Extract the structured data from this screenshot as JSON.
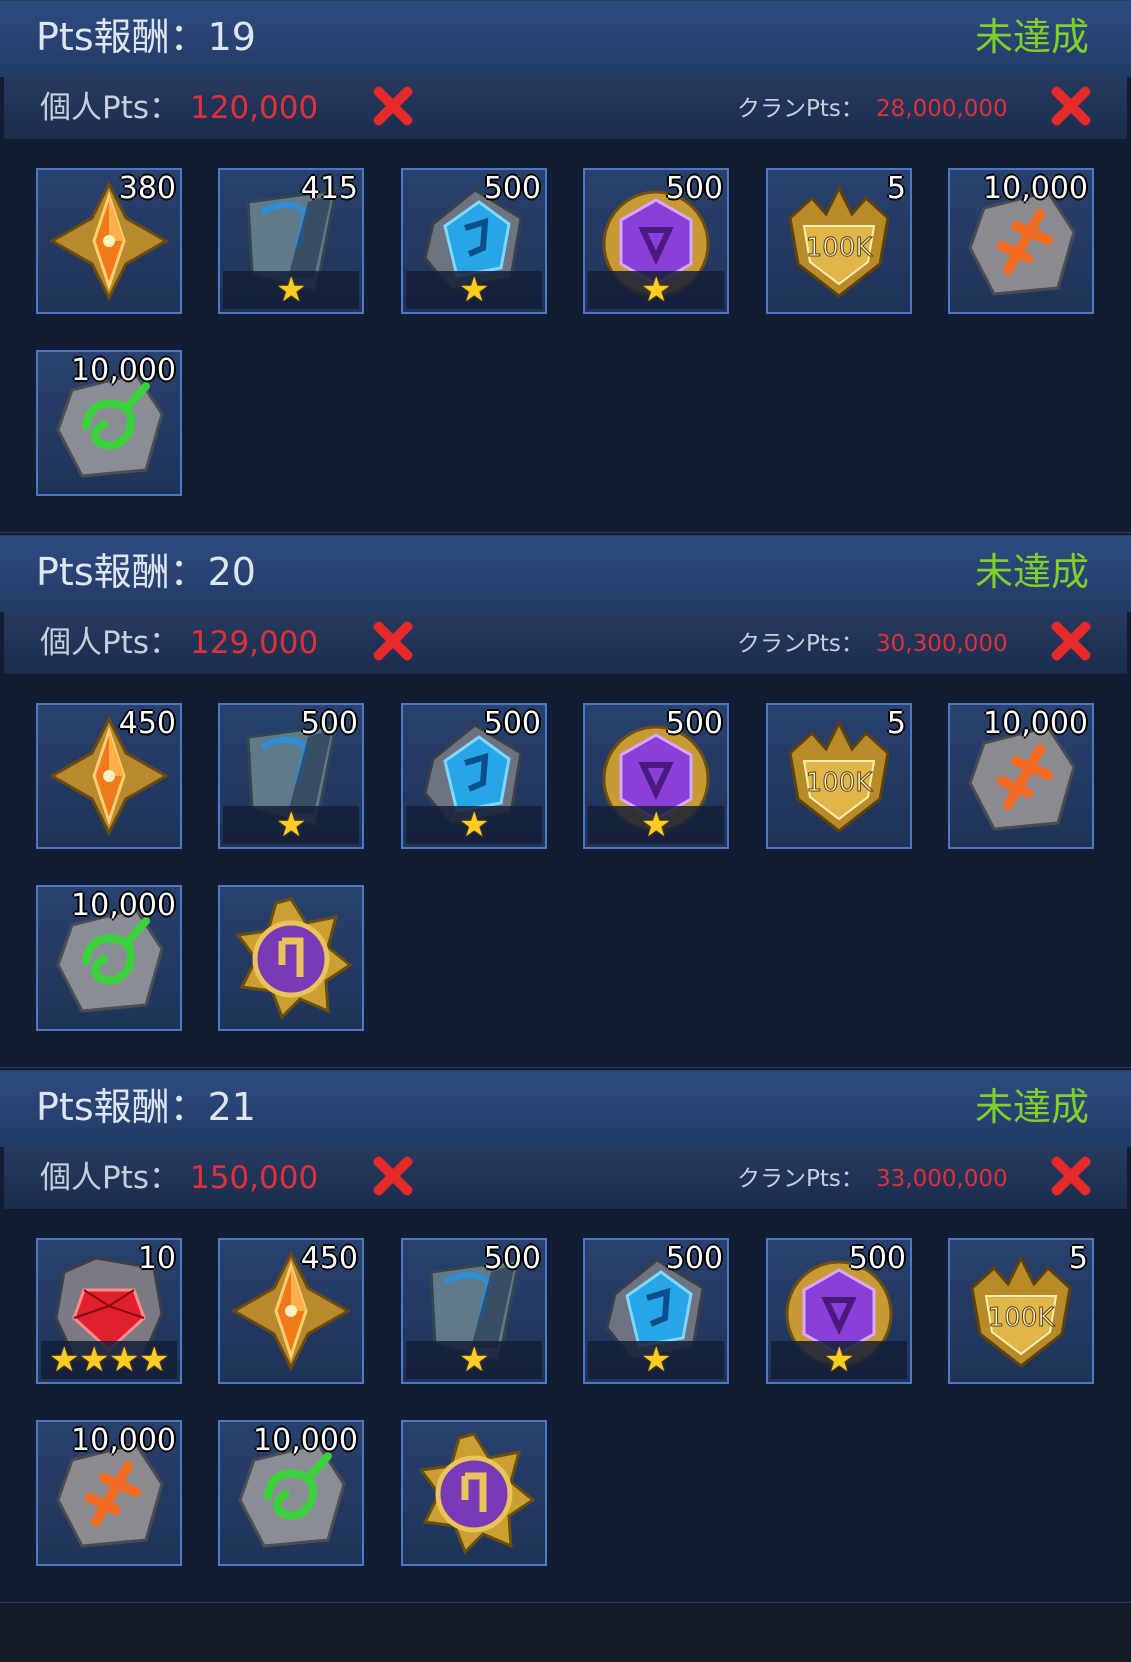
{
  "panels": [
    {
      "title": "Pts報酬：19",
      "status": "未達成",
      "personal_label": "個人Pts：",
      "personal_value": "120,000",
      "clan_label": "クランPts：",
      "clan_value": "28,000,000",
      "items": [
        {
          "icon": "orange-crystal-emblem-icon",
          "qty": "380"
        },
        {
          "icon": "blue-shard-icon",
          "qty": "415",
          "stars": 1
        },
        {
          "icon": "blue-gem-icon",
          "qty": "500",
          "stars": 1
        },
        {
          "icon": "purple-gem-icon",
          "qty": "500",
          "stars": 1
        },
        {
          "icon": "gold-100k-badge-icon",
          "qty": "5"
        },
        {
          "icon": "orange-rune-stone-icon",
          "qty": "10,000"
        },
        {
          "icon": "green-rune-stone-icon",
          "qty": "10,000"
        }
      ]
    },
    {
      "title": "Pts報酬：20",
      "status": "未達成",
      "personal_label": "個人Pts：",
      "personal_value": "129,000",
      "clan_label": "クランPts：",
      "clan_value": "30,300,000",
      "items": [
        {
          "icon": "orange-crystal-emblem-icon",
          "qty": "450"
        },
        {
          "icon": "blue-shard-icon",
          "qty": "500",
          "stars": 1
        },
        {
          "icon": "blue-gem-icon",
          "qty": "500",
          "stars": 1
        },
        {
          "icon": "purple-gem-icon",
          "qty": "500",
          "stars": 1
        },
        {
          "icon": "gold-100k-badge-icon",
          "qty": "5"
        },
        {
          "icon": "orange-rune-stone-icon",
          "qty": "10,000"
        },
        {
          "icon": "green-rune-stone-icon",
          "qty": "10,000"
        },
        {
          "icon": "purple-gold-medallion-icon",
          "qty": ""
        }
      ]
    },
    {
      "title": "Pts報酬：21",
      "status": "未達成",
      "personal_label": "個人Pts：",
      "personal_value": "150,000",
      "clan_label": "クランPts：",
      "clan_value": "33,000,000",
      "items": [
        {
          "icon": "red-ruby-icon",
          "qty": "10",
          "stars": 4
        },
        {
          "icon": "orange-crystal-emblem-icon",
          "qty": "450"
        },
        {
          "icon": "blue-shard-icon",
          "qty": "500",
          "stars": 1
        },
        {
          "icon": "blue-gem-icon",
          "qty": "500",
          "stars": 1
        },
        {
          "icon": "purple-gem-icon",
          "qty": "500",
          "stars": 1
        },
        {
          "icon": "gold-100k-badge-icon",
          "qty": "5"
        },
        {
          "icon": "orange-rune-stone-icon",
          "qty": "10,000"
        },
        {
          "icon": "green-rune-stone-icon",
          "qty": "10,000"
        },
        {
          "icon": "purple-gold-medallion-icon",
          "qty": ""
        }
      ]
    }
  ],
  "badge_text": "100K",
  "colors": {
    "header": "#2f4c80",
    "status_green": "#7fd02a",
    "value_red": "#e0303a",
    "tile_border": "#4f78c4",
    "x_mark": "#e62a2a"
  }
}
